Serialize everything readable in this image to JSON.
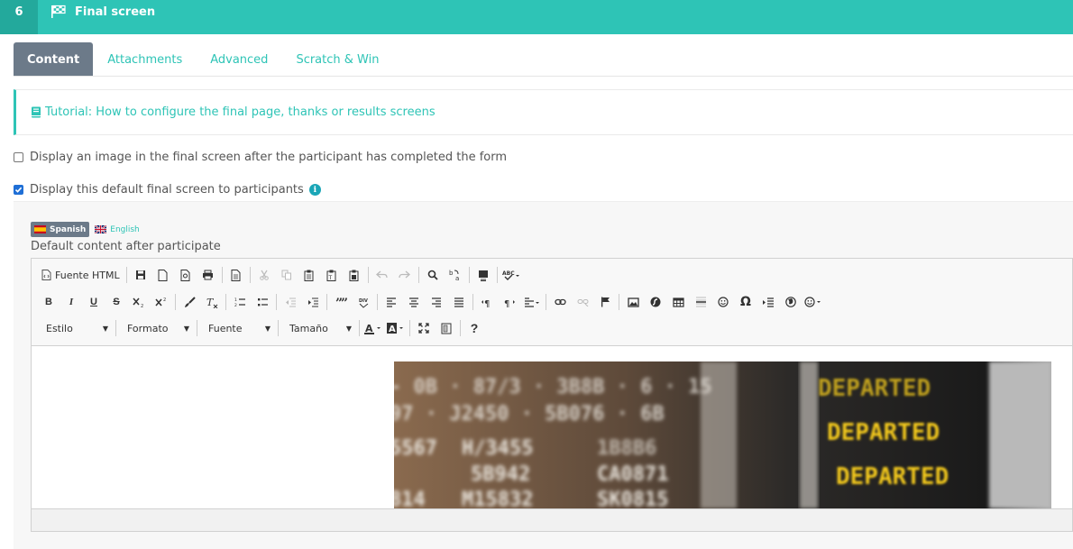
{
  "header": {
    "step_number": "6",
    "title": "Final screen",
    "title_icon": "checkered-flag-icon",
    "bg_color": "#2ec4b6",
    "step_bg_color": "#23a99c"
  },
  "tabs": [
    {
      "label": "Content",
      "active": true
    },
    {
      "label": "Attachments",
      "active": false
    },
    {
      "label": "Advanced",
      "active": false
    },
    {
      "label": "Scratch & Win",
      "active": false
    }
  ],
  "tutorial": {
    "icon": "book-icon",
    "link_text": "Tutorial: How to configure the final page, thanks or results screens"
  },
  "options": {
    "display_image": {
      "label": "Display an image in the final screen after the participant has completed the form",
      "checked": false
    },
    "display_default": {
      "label": "Display this default final screen to participants",
      "checked": true,
      "info_icon": "info-icon",
      "info_glyph": "i"
    }
  },
  "languages": {
    "active": "Spanish",
    "other": "English"
  },
  "editor": {
    "label": "Default content after participate",
    "toolbar": {
      "html_source_label": "Fuente HTML",
      "dropdowns": {
        "style": "Estilo",
        "format": "Formato",
        "font": "Fuente",
        "size": "Tamaño"
      },
      "bold": "B",
      "italic": "I",
      "underline": "U",
      "strike": "S",
      "help": "?",
      "omega": "Ω"
    },
    "image": {
      "description_words": [
        "DEPARTED",
        "DEPARTED",
        "DEPARTED"
      ],
      "board_texts": [
        "5567",
        "H/3455",
        "5B942",
        "CA0871",
        "814",
        "M15832",
        "SK0815"
      ]
    }
  },
  "colors": {
    "accent": "#2ec4b6",
    "tab_active_bg": "#6c7a89",
    "checkbox_checked": "#1f6fd6",
    "info": "#1aa6b7"
  }
}
